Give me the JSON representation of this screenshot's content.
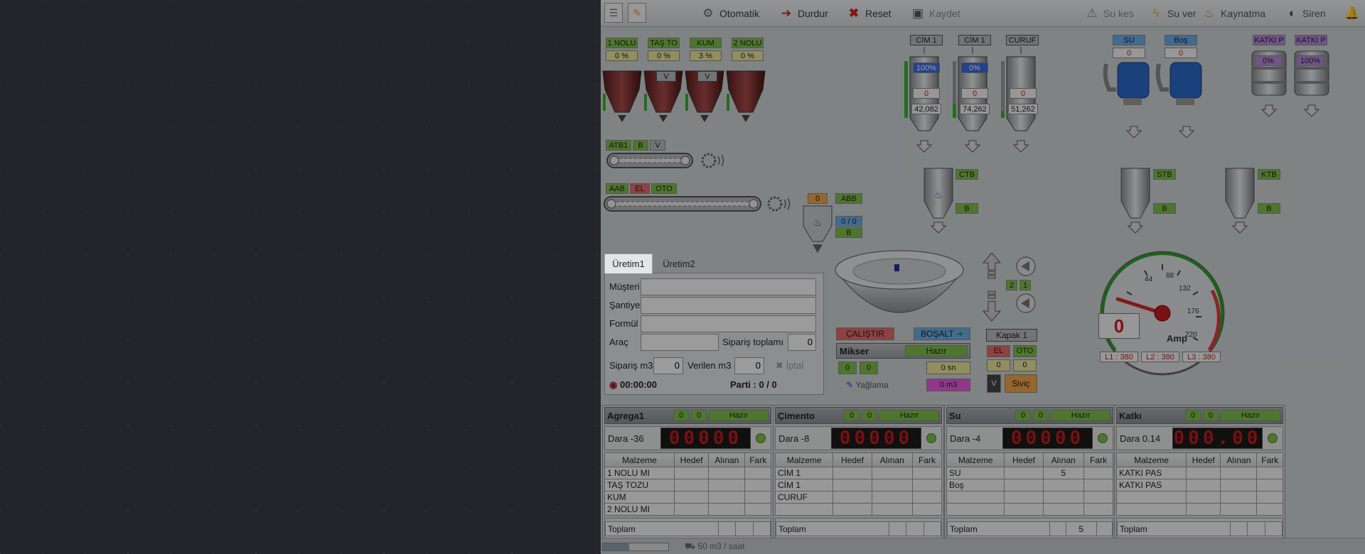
{
  "toolbar": {
    "auto": "Otomatik",
    "stop": "Durdur",
    "reset": "Reset",
    "save": "Kaydet",
    "water_off": "Su kes",
    "water_on": "Su ver",
    "boil": "Kaynatma",
    "siren": "Siren"
  },
  "aggregates": [
    {
      "name": "1 NOLU",
      "pct": "0 %"
    },
    {
      "name": "TAŞ TO",
      "pct": "0 %"
    },
    {
      "name": "KUM",
      "pct": "3 %"
    },
    {
      "name": "2 NOLU",
      "pct": "0 %"
    }
  ],
  "hopper_v": "V",
  "cement": [
    {
      "name": "CİM 1",
      "pct": "100%",
      "zero": "0",
      "kg": "42,082"
    },
    {
      "name": "CİM 1",
      "pct": "0%",
      "zero": "0",
      "kg": "74,262"
    },
    {
      "name": "CURUF",
      "pct": "",
      "zero": "0",
      "kg": "51,262"
    }
  ],
  "water": [
    {
      "name": "SU",
      "zero": "0"
    },
    {
      "name": "Boş",
      "zero": "0"
    }
  ],
  "additive": [
    {
      "name": "KATKI P",
      "pct": "0%"
    },
    {
      "name": "KATKI P",
      "pct": "100%"
    }
  ],
  "belt1": {
    "a": "ATB1",
    "b": "B",
    "v": "V"
  },
  "belt2": {
    "a": "AAB",
    "b": "EL",
    "c": "OTO"
  },
  "abb": {
    "zero": "0",
    "label": "ABB",
    "ratio": "0 / 0",
    "b": "B"
  },
  "ctb": {
    "label": "CTB",
    "b": "B"
  },
  "stb": {
    "label": "STB",
    "b": "B"
  },
  "ktb": {
    "label": "KTB",
    "b": "B"
  },
  "tabs": [
    "Üretim1",
    "Üretim2"
  ],
  "form": {
    "customer": "Müşteri",
    "site": "Şantiye",
    "formula": "Formül",
    "vehicle": "Araç",
    "order_total": "Sipariş toplamı",
    "order_total_val": "0",
    "order_m3": "Sipariş m3",
    "order_m3_val": "0",
    "delivered": "Verilen m3",
    "delivered_val": "0",
    "cancel": "İptal",
    "time": "00:00:00",
    "batch": "Parti : 0 / 0"
  },
  "mixer": {
    "run": "ÇALIŞTIR",
    "unload": "BOŞALT",
    "title": "Mikser",
    "status": "Hazır",
    "c1": "0",
    "c2": "0",
    "sec": "0 sn",
    "m3": "0 m3",
    "grease": "Yağlama",
    "n2": "2",
    "n1": "1"
  },
  "cover": {
    "title": "Kapak 1",
    "el": "EL",
    "oto": "OTO",
    "z1": "0",
    "z2": "0",
    "v": "V",
    "level": "Siviç"
  },
  "gauge": {
    "value": "0",
    "unit": "Amp",
    "ticks": [
      "44",
      "88",
      "132",
      "176",
      "220"
    ],
    "l1": "L1 : 380",
    "l2": "L2 : 380",
    "l3": "L3 : 380",
    "level": 0
  },
  "sections": [
    {
      "title": "Agrega1",
      "c1": "0",
      "c2": "0",
      "status": "Hazır",
      "tare": "Dara -36",
      "led": "00000",
      "rows": [
        [
          "1 NOLU MI",
          "",
          "",
          ""
        ],
        [
          "TAŞ TOZU",
          "",
          "",
          ""
        ],
        [
          "KUM",
          "",
          "",
          ""
        ],
        [
          "2 NOLU MI",
          "",
          "",
          ""
        ]
      ],
      "total": [
        "Toplam",
        "",
        "",
        ""
      ]
    },
    {
      "title": "Çimento",
      "c1": "0",
      "c2": "0",
      "status": "Hazır",
      "tare": "Dara -8",
      "led": "00000",
      "rows": [
        [
          "CİM 1",
          "",
          "",
          ""
        ],
        [
          "CİM 1",
          "",
          "",
          ""
        ],
        [
          "CURUF",
          "",
          "",
          ""
        ],
        [
          "",
          "",
          "",
          ""
        ]
      ],
      "total": [
        "Toplam",
        "",
        "",
        ""
      ]
    },
    {
      "title": "Su",
      "c1": "0",
      "c2": "0",
      "status": "Hazır",
      "tare": "Dara -4",
      "led": "00000",
      "rows": [
        [
          "SU",
          "",
          "5",
          ""
        ],
        [
          "Boş",
          "",
          "",
          ""
        ],
        [
          "",
          "",
          "",
          ""
        ],
        [
          "",
          "",
          "",
          ""
        ]
      ],
      "total": [
        "Toplam",
        "",
        "5",
        ""
      ]
    },
    {
      "title": "Katkı",
      "c1": "0",
      "c2": "0",
      "status": "Hazır",
      "tare": "Dara 0.14",
      "led": "000.00",
      "rows": [
        [
          "KATKI PAS",
          "",
          "",
          ""
        ],
        [
          "KATKI PAS",
          "",
          "",
          ""
        ],
        [
          "",
          "",
          "",
          ""
        ],
        [
          "",
          "",
          "",
          ""
        ]
      ],
      "total": [
        "Toplam",
        "",
        "",
        ""
      ]
    }
  ],
  "table_headers": [
    "Malzeme",
    "Hedef",
    "Alınan",
    "Fark"
  ],
  "status_bar": {
    "rate": "50 m3 / saat"
  }
}
